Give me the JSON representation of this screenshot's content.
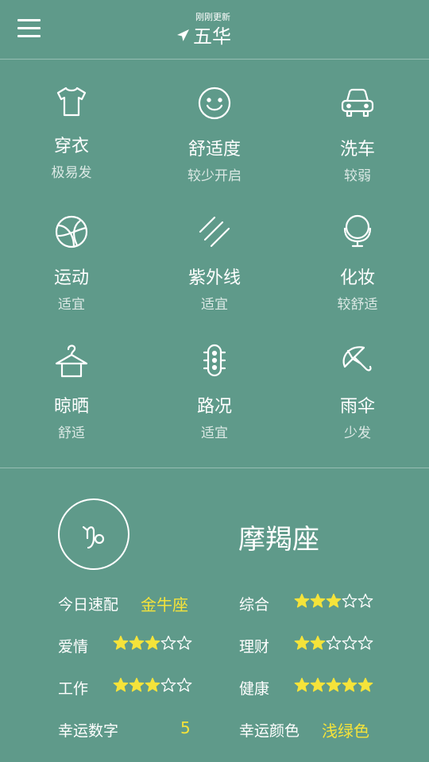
{
  "header": {
    "update_status": "刚刚更新",
    "city": "五华",
    "menu_icon": "hamburger-menu-icon",
    "location_icon": "location-arrow-icon"
  },
  "indices": [
    {
      "name": "穿衣",
      "value": "极易发",
      "icon": "tshirt-icon"
    },
    {
      "name": "舒适度",
      "value": "较少开启",
      "icon": "smiley-icon"
    },
    {
      "name": "洗车",
      "value": "较弱",
      "icon": "car-icon"
    },
    {
      "name": "运动",
      "value": "适宜",
      "icon": "ball-icon"
    },
    {
      "name": "紫外线",
      "value": "适宜",
      "icon": "uv-rays-icon"
    },
    {
      "name": "化妆",
      "value": "较舒适",
      "icon": "mirror-icon"
    },
    {
      "name": "晾晒",
      "value": "舒适",
      "icon": "hanger-icon"
    },
    {
      "name": "路况",
      "value": "适宜",
      "icon": "traffic-light-icon"
    },
    {
      "name": "雨伞",
      "value": "少发",
      "icon": "umbrella-icon"
    }
  ],
  "horoscope": {
    "sign": "摩羯座",
    "sign_icon": "capricorn-icon",
    "match_label": "今日速配",
    "match_value": "金牛座",
    "overall_label": "综合",
    "overall_stars": 3,
    "love_label": "爱情",
    "love_stars": 3,
    "finance_label": "理财",
    "finance_stars": 2,
    "work_label": "工作",
    "work_stars": 3,
    "health_label": "健康",
    "health_stars": 5,
    "lucky_number_label": "幸运数字",
    "lucky_number": "5",
    "lucky_color_label": "幸运颜色",
    "lucky_color": "浅绿色",
    "max_stars": 5
  },
  "colors": {
    "background": "#5f9a8a",
    "star_filled": "#f5e33a",
    "highlight_text": "#f5e33a"
  }
}
